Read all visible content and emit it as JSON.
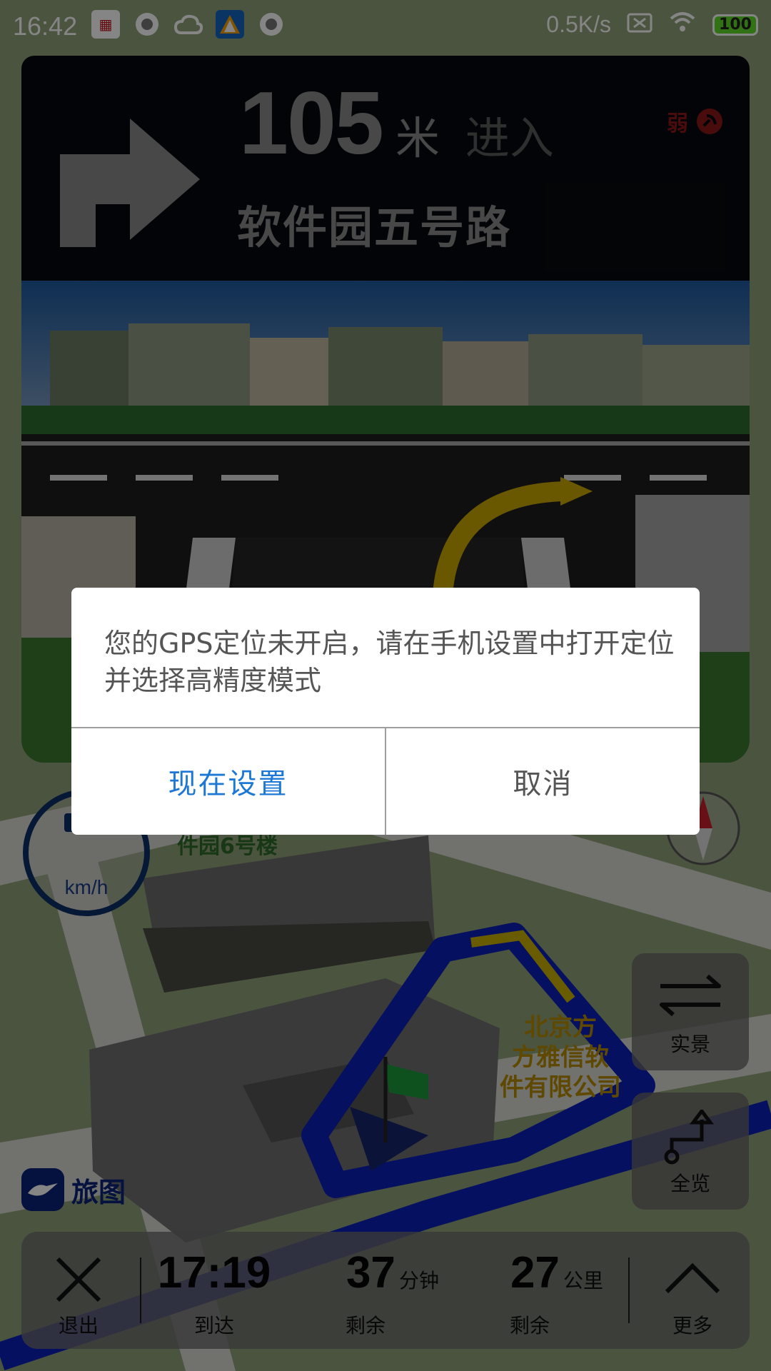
{
  "statusbar": {
    "time": "16:42",
    "network_speed": "0.5K/s",
    "battery": "100",
    "icons": [
      "news-app-icon",
      "circle-app-icon",
      "cloud-icon",
      "map-app-icon",
      "circle-app-icon-2",
      "sim-off-icon",
      "wifi-icon",
      "battery-icon"
    ]
  },
  "guidance": {
    "turn": "right-turn",
    "distance_value": "105",
    "distance_unit": "米",
    "action": "进入",
    "road_name": "软件园五号路",
    "gps_signal_label": "弱",
    "gps_signal_color": "#8c1717"
  },
  "map": {
    "speed_unit": "km/h",
    "building_label": "件园6号楼",
    "poi_label_lines": [
      "北京方",
      "方雅信软",
      "件有限公司"
    ],
    "brand_logo_text": "旅图"
  },
  "side_buttons": {
    "live_view_label": "实景",
    "overview_label": "全览"
  },
  "bottom_bar": {
    "exit_label": "退出",
    "arrival_time": "17:19",
    "arrival_label": "到达",
    "remaining_time_value": "37",
    "remaining_time_unit": "分钟",
    "remaining_time_label": "剩余",
    "remaining_distance_value": "27",
    "remaining_distance_unit": "公里",
    "remaining_distance_label": "剩余",
    "more_label": "更多"
  },
  "dialog": {
    "message": "您的GPS定位未开启，请在手机设置中打开定位并选择高精度模式",
    "confirm_label": "现在设置",
    "cancel_label": "取消",
    "confirm_color": "#1c78d4"
  }
}
